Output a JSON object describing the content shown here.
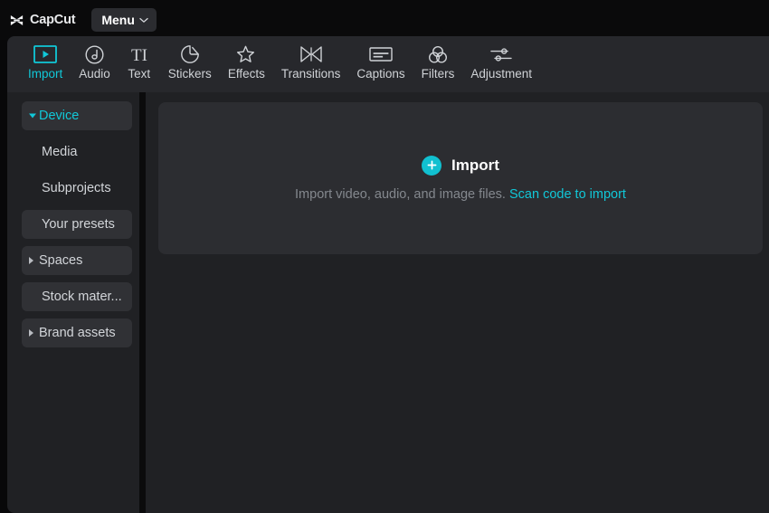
{
  "app": {
    "brand_name": "CapCut",
    "brand_icon": "capcut-logo-icon"
  },
  "titlebar": {
    "menu_label": "Menu",
    "menu_chevron_icon": "chevron-down-icon"
  },
  "toolbar": {
    "active_tab": "Import",
    "tabs": [
      {
        "label": "Import",
        "icon": "import-play-frame-icon",
        "active": true
      },
      {
        "label": "Audio",
        "icon": "music-note-circle-icon",
        "active": false
      },
      {
        "label": "Text",
        "icon": "text-ti-icon",
        "active": false
      },
      {
        "label": "Stickers",
        "icon": "sticker-peel-icon",
        "active": false
      },
      {
        "label": "Effects",
        "icon": "sparkle-star-icon",
        "active": false
      },
      {
        "label": "Transitions",
        "icon": "transition-bowtie-icon",
        "active": false
      },
      {
        "label": "Captions",
        "icon": "captions-box-icon",
        "active": false
      },
      {
        "label": "Filters",
        "icon": "filters-three-circles-icon",
        "active": false
      },
      {
        "label": "Adjustment",
        "icon": "adjustment-sliders-icon",
        "active": false
      }
    ]
  },
  "sidebar": {
    "items": [
      {
        "label": "Device",
        "caret": "down",
        "selected": true,
        "child": false,
        "accent": true
      },
      {
        "label": "Media",
        "caret": "none",
        "selected": false,
        "child": true,
        "accent": false
      },
      {
        "label": "Subprojects",
        "caret": "none",
        "selected": false,
        "child": true,
        "accent": false
      },
      {
        "label": "Your presets",
        "caret": "none",
        "selected": true,
        "child": true,
        "accent": false
      },
      {
        "label": "Spaces",
        "caret": "right",
        "selected": true,
        "child": false,
        "accent": false
      },
      {
        "label": "Stock mater...",
        "caret": "none",
        "selected": true,
        "child": true,
        "accent": false
      },
      {
        "label": "Brand assets",
        "caret": "right",
        "selected": true,
        "child": false,
        "accent": false
      }
    ]
  },
  "main": {
    "dropzone": {
      "plus_icon": "plus-icon",
      "title": "Import",
      "description": "Import video, audio, and image files.",
      "scan_link": "Scan code to import"
    }
  },
  "colors": {
    "accent": "#11c8d8",
    "accent_fill": "#11c0d0",
    "panel_bg": "#202124",
    "toolbar_bg": "#27282c",
    "titlebar_bg": "#0a0a0b",
    "dropzone_bg": "#2c2d31",
    "item_selected_bg": "#303135",
    "text_primary": "#d2d5d9",
    "text_muted": "#84888e"
  }
}
